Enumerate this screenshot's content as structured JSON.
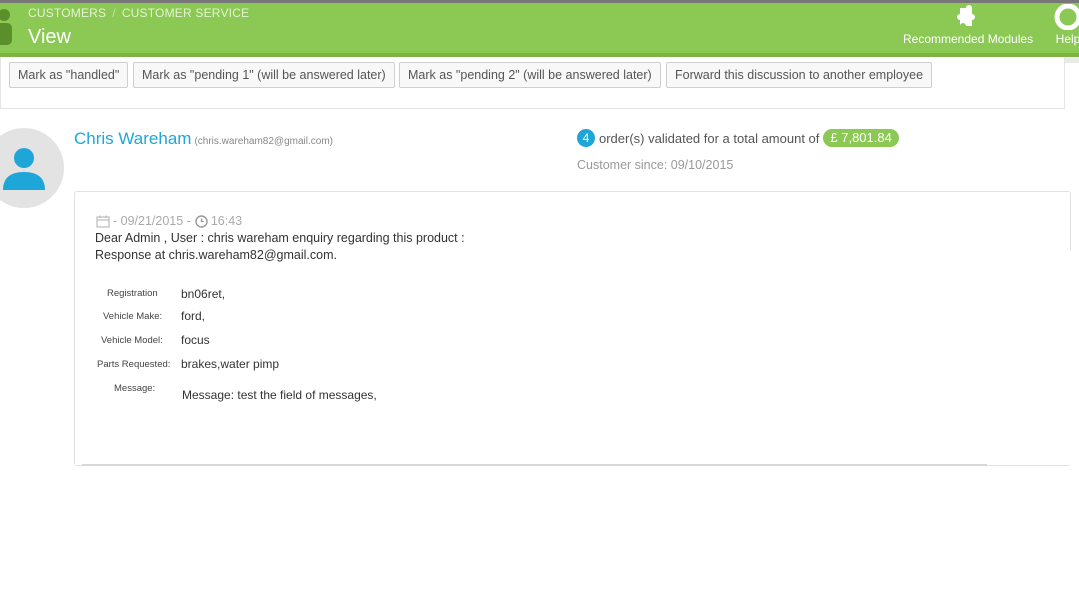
{
  "header": {
    "breadcrumb": [
      "CUSTOMERS",
      "CUSTOMER SERVICE"
    ],
    "breadcrumb_separator": "/",
    "title": "View",
    "actions": [
      {
        "label": "Recommended Modules",
        "icon": "puzzle-icon"
      },
      {
        "label": "Help",
        "icon": "lifebuoy-icon"
      }
    ],
    "brand_color": "#8bc954"
  },
  "toolbar": {
    "buttons": [
      "Mark as \"handled\"",
      "Mark as \"pending 1\" (will be answered later)",
      "Mark as \"pending 2\" (will be answered later)",
      "Forward this discussion to another employee"
    ]
  },
  "customer": {
    "name": "Chris Wareham",
    "email": "(chris.wareham82@gmail.com)",
    "order_count": "4",
    "orders_text": "order(s) validated for a total amount of",
    "total_amount": "£ 7,801.84",
    "customer_since": "Customer since: 09/10/2015",
    "accent_color": "#1fa6d8"
  },
  "message": {
    "date": "- 09/21/2015 -",
    "time": "16:43",
    "line1": "Dear Admin , User : chris wareham enquiry regarding this product :",
    "line2": "Response at chris.wareham82@gmail.com.",
    "fields": [
      {
        "label": "Registration",
        "value": "bn06ret,"
      },
      {
        "label": "Vehicle Make:",
        "value": "ford,"
      },
      {
        "label": "Vehicle Model:",
        "value": "focus"
      },
      {
        "label": "Parts Requested:",
        "value": "brakes,water pimp"
      },
      {
        "label": "Message:",
        "value": "Message: test the field of messages,"
      }
    ]
  }
}
